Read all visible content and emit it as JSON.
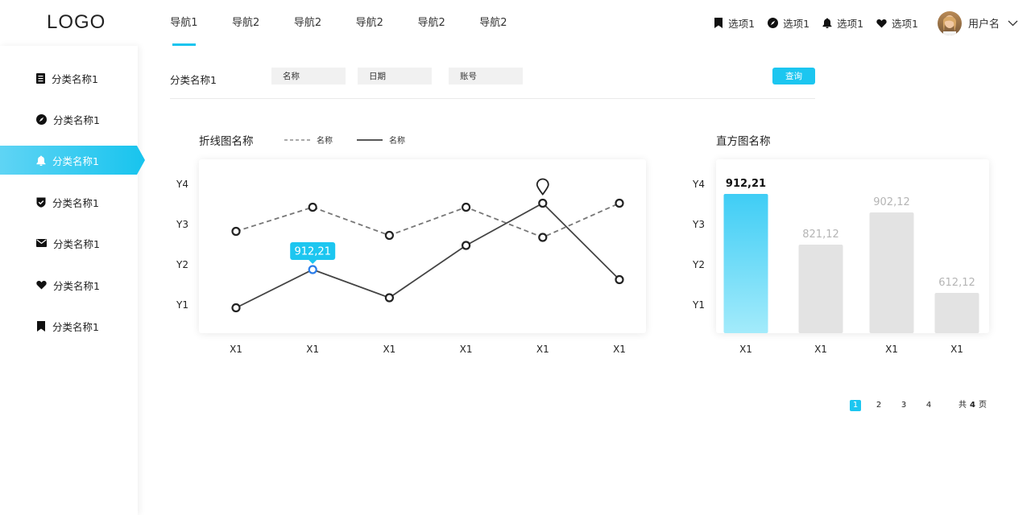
{
  "header": {
    "logo": "LOGO",
    "nav": [
      {
        "label": "导航1",
        "active": true
      },
      {
        "label": "导航2"
      },
      {
        "label": "导航2"
      },
      {
        "label": "导航2"
      },
      {
        "label": "导航2"
      },
      {
        "label": "导航2"
      }
    ],
    "options": [
      {
        "label": "选项1",
        "icon": "bookmark-icon"
      },
      {
        "label": "选项1",
        "icon": "compass-icon"
      },
      {
        "label": "选项1",
        "icon": "bell-icon"
      },
      {
        "label": "选项1",
        "icon": "heart-icon"
      }
    ],
    "user": {
      "name": "用户名",
      "icon": "chevron-down-icon"
    }
  },
  "sidebar": {
    "items": [
      {
        "label": "分类名称1",
        "icon": "document-icon"
      },
      {
        "label": "分类名称1",
        "icon": "compass-icon"
      },
      {
        "label": "分类名称1",
        "icon": "bell-icon",
        "active": true
      },
      {
        "label": "分类名称1",
        "icon": "shield-icon"
      },
      {
        "label": "分类名称1",
        "icon": "mail-icon"
      },
      {
        "label": "分类名称1",
        "icon": "heart-icon"
      },
      {
        "label": "分类名称1",
        "icon": "bookmark-icon"
      }
    ]
  },
  "filter": {
    "label": "分类名称1",
    "name_placeholder": "名称",
    "date_placeholder": "日期",
    "account_placeholder": "账号",
    "query_label": "查询"
  },
  "colors": {
    "accent": "#1cc6f0",
    "bar_inactive": "#e3e3e3",
    "line": "#444444",
    "dashed": "#777777"
  },
  "chart_data": [
    {
      "type": "line",
      "title": "折线图名称",
      "y_categories": [
        "Y1",
        "Y2",
        "Y3",
        "Y4"
      ],
      "x": [
        "X1",
        "X1",
        "X1",
        "X1",
        "X1",
        "X1"
      ],
      "series": [
        {
          "name": "名称",
          "style": "dashed",
          "values": [
            2.85,
            3.45,
            2.75,
            3.45,
            2.7,
            3.55
          ]
        },
        {
          "name": "名称",
          "style": "solid",
          "values": [
            0.95,
            1.9,
            1.2,
            2.5,
            3.55,
            1.65
          ]
        }
      ],
      "highlight": {
        "series": 1,
        "index": 1,
        "label": "912,21"
      },
      "marker": {
        "series": 1,
        "index": 4,
        "icon": "location-pin-icon"
      }
    },
    {
      "type": "bar",
      "title": "直方图名称",
      "y_categories": [
        "Y1",
        "Y2",
        "Y3",
        "Y4"
      ],
      "categories": [
        "X1",
        "X1",
        "X1",
        "X1"
      ],
      "values": [
        3.78,
        2.52,
        3.32,
        1.32
      ],
      "data_labels": [
        "912,21",
        "821,12",
        "902,12",
        "612,12"
      ],
      "active_index": 0
    }
  ],
  "pagination": {
    "pages": [
      "1",
      "2",
      "3",
      "4"
    ],
    "current": "1",
    "total_prefix": "共",
    "total_count": "4",
    "total_suffix": "页"
  }
}
